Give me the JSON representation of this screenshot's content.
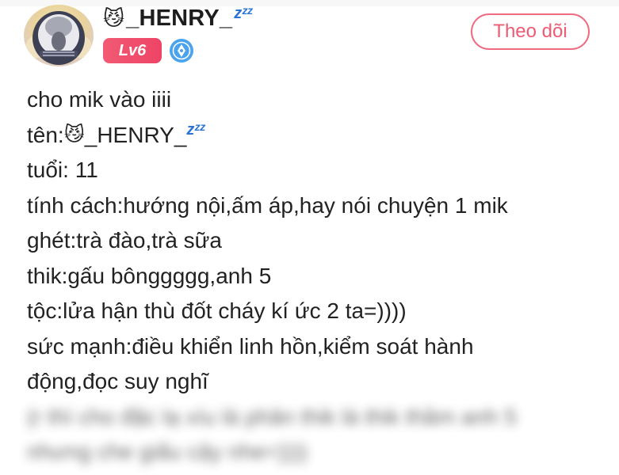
{
  "user": {
    "name_emoji": "😼",
    "name": "_HENRY_",
    "name_zzz": "zᶻᶻ",
    "level": "Lv6"
  },
  "actions": {
    "follow_label": "Theo dõi"
  },
  "icons": {
    "avatar": "white-helmet-astronaut-avatar",
    "verify": "blue-pen-badge-icon"
  },
  "colors": {
    "accent": "#ef5b73",
    "level_badge": "#ee4466",
    "verify_badge": "#4aa3ec",
    "zzz": "#2a74d8"
  },
  "post": {
    "line1": "cho mik vào iiii",
    "line2_prefix": "tên:",
    "line2_emoji": "😼",
    "line2_name": "_HENRY_",
    "line2_zzz": "zᶻᶻ",
    "line3": "tuổi: 11",
    "line4": "tính cách:hướng nội,ấm áp,hay nói chuyện 1 mik",
    "line5": "ghét:trà đào,trà sữa",
    "line6": "thik:gấu bônggggg,anh 5",
    "line7": "tộc:lửa hận thù đốt cháy kí ức 2 ta=))))",
    "line8": "sức mạnh:điều khiển linh hồn,kiểm soát hành",
    "line9": "động,đọc suy nghĩ",
    "line10_blurred": "(r thì cho đặc lạ xíu là phân thik là thik thầm anh 5",
    "line11_blurred": "nhưng che giấu cậy nhe=))))"
  }
}
